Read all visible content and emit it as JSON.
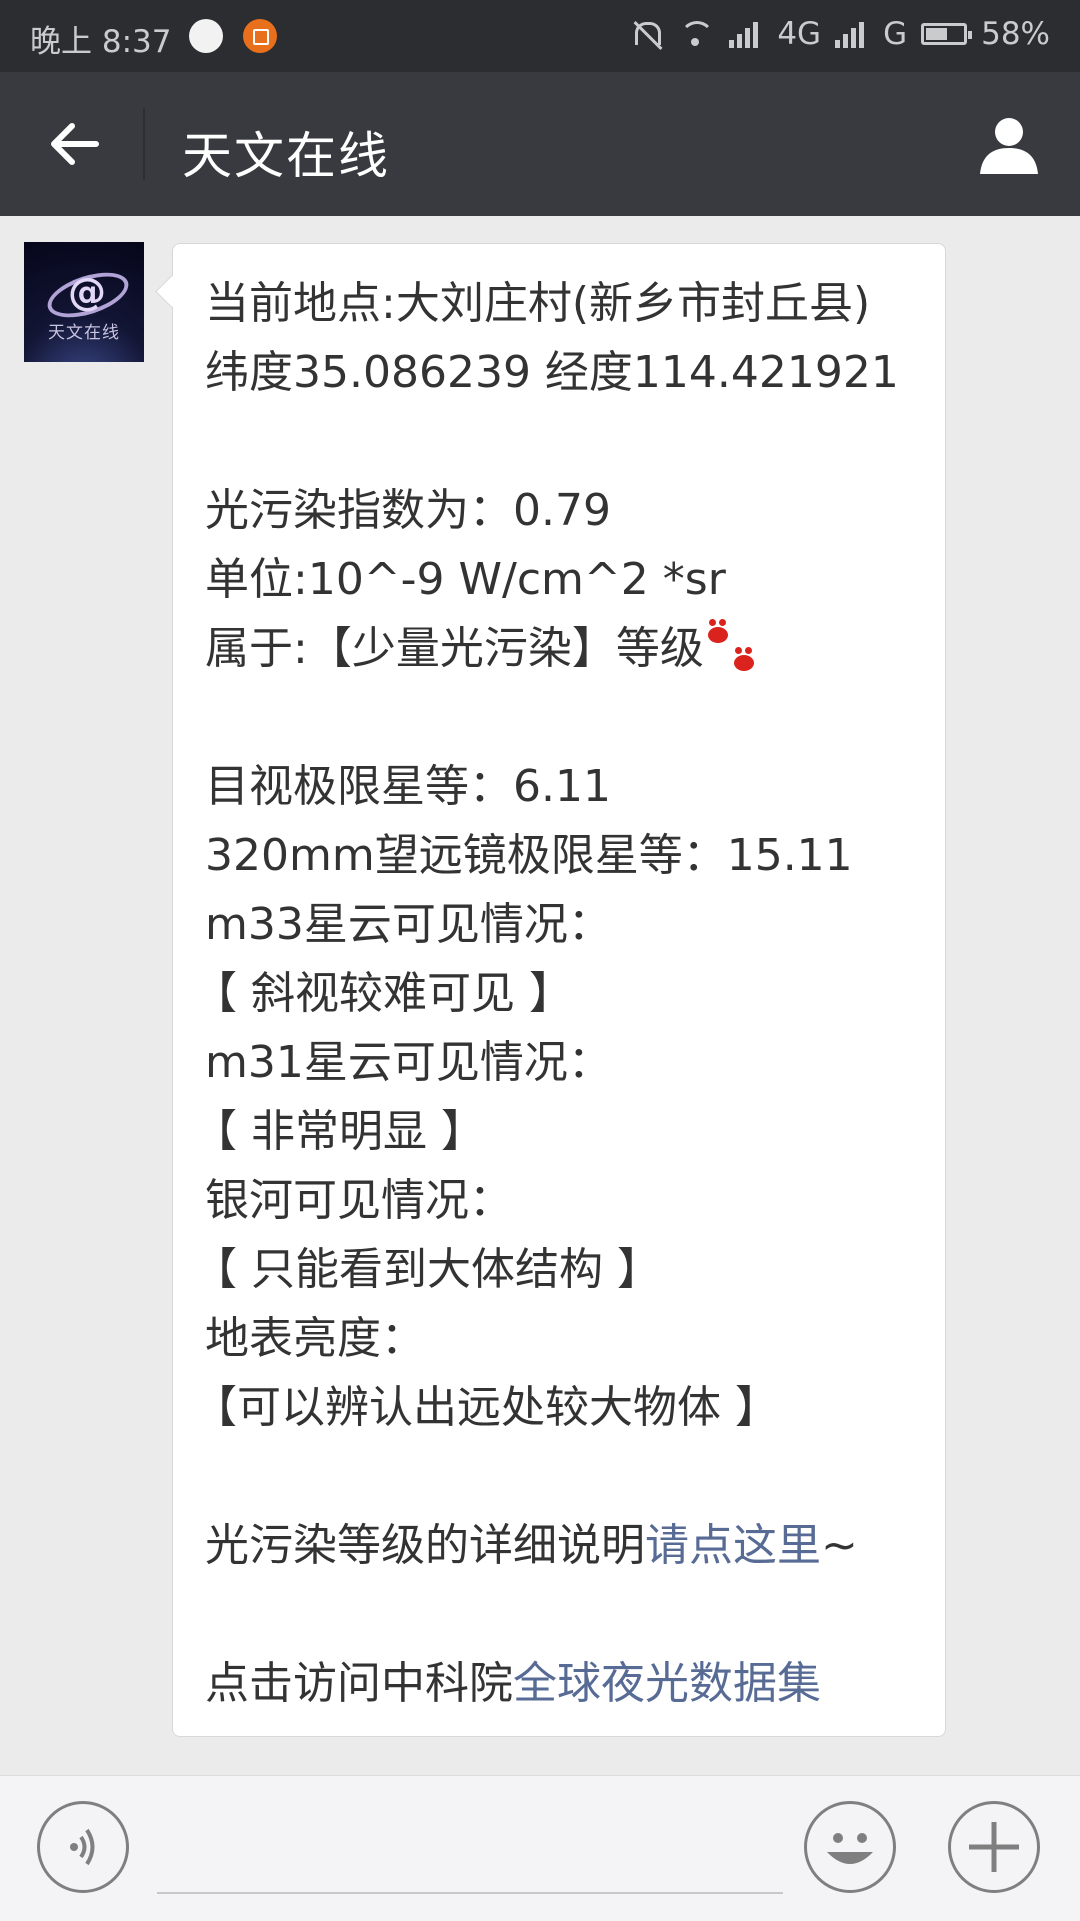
{
  "status_bar": {
    "time": "晚上 8:37",
    "network_1": "4G",
    "network_2": "G",
    "battery": "58%",
    "battery_level": 0.58
  },
  "title_bar": {
    "title": "天文在线",
    "back_icon": "arrow-left-icon",
    "profile_icon": "person-icon"
  },
  "chat": {
    "avatar_text": "天文在线",
    "message_lines": [
      "当前地点:大刘庄村(新乡市封丘县)",
      "纬度35.086239  经度114.421921",
      "光污染指数为：0.79",
      "单位:10^-9 W/cm^2 *sr",
      "属于:【少量光污染】等级",
      "目视极限星等：6.11",
      "320mm望远镜极限星等：15.11",
      "m33星云可见情况：",
      "【 斜视较难可见 】",
      "m31星云可见情况：",
      "【 非常明显 】",
      "银河可见情况：",
      "【 只能看到大体结构 】",
      "地表亮度：",
      "【可以辨认出远处较大物体 】"
    ],
    "detail_prefix": "光污染等级的详细说明",
    "detail_link": "请点这里",
    "detail_suffix": "~",
    "visit_prefix": "点击访问中科院",
    "visit_link": "全球夜光数据集",
    "link_color": "#576b95"
  },
  "input_bar": {
    "voice_icon": "voice-icon",
    "emoji_icon": "emoji-icon",
    "plus_icon": "plus-icon",
    "placeholder": ""
  }
}
